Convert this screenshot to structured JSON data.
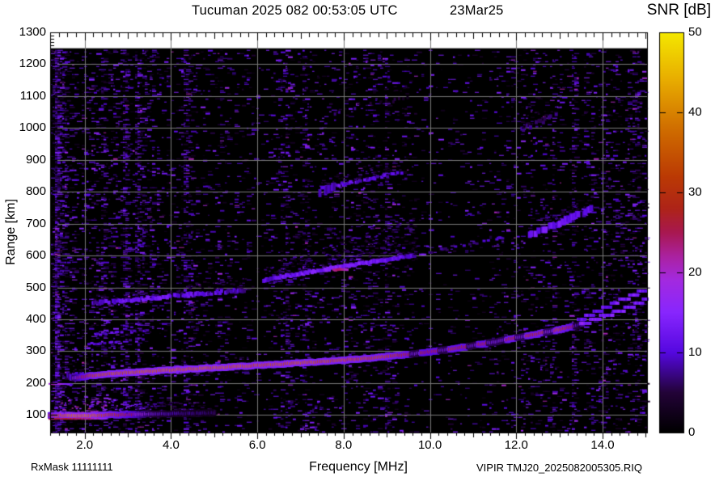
{
  "header": {
    "title": "Tucuman 2025 082 00:53:05 UTC",
    "date": "23Mar25"
  },
  "footer": {
    "rx_mask": "RxMask 11111111",
    "file_id": "VIPIR  TMJ20_2025082005305.RIQ"
  },
  "chart_data": {
    "type": "heatmap",
    "title": "Tucuman 2025 082 00:53:05 UTC  23Mar25",
    "xlabel": "Frequency [MHz]",
    "ylabel": "Range [km]",
    "colorbar_label": "SNR [dB]",
    "xlim": [
      1.2,
      15.03
    ],
    "ylim": [
      45,
      1300
    ],
    "data_top_km": 1250,
    "grid": true,
    "grid_color": "#787878",
    "plot_bg": "#000000",
    "page_bg": "#ffffff",
    "x_ticks": [
      2,
      4,
      6,
      8,
      10,
      12,
      14
    ],
    "x_tick_labels": [
      "2.0",
      "4.0",
      "6.0",
      "8.0",
      "10.0",
      "12.0",
      "14.0"
    ],
    "y_ticks": [
      100,
      200,
      300,
      400,
      500,
      600,
      700,
      800,
      900,
      1000,
      1100,
      1200,
      1300
    ],
    "colorbar": {
      "min": 0,
      "max": 50,
      "ticks": [
        0,
        10,
        20,
        30,
        40,
        50
      ],
      "stops": [
        [
          0,
          "#000000"
        ],
        [
          5,
          "#230338"
        ],
        [
          10,
          "#5508e0"
        ],
        [
          15,
          "#8826fe"
        ],
        [
          19,
          "#a32ae0"
        ],
        [
          22,
          "#ab22a0"
        ],
        [
          25,
          "#a81850"
        ],
        [
          28,
          "#ae2418"
        ],
        [
          32,
          "#bb3a04"
        ],
        [
          38,
          "#d06e00"
        ],
        [
          44,
          "#e8ac00"
        ],
        [
          50,
          "#f4e800"
        ]
      ]
    },
    "noise": {
      "base_density": 0.085,
      "snr_range": [
        2,
        15
      ],
      "bright_prob": 0.07,
      "dense_regions": [
        [
          1.2,
          1.55,
          2.1
        ],
        [
          1.2,
          3.6,
          1.55
        ],
        [
          13.6,
          15.03,
          1.45
        ],
        [
          9.6,
          11.6,
          0.6
        ]
      ],
      "stripes": [
        1.35,
        2.4,
        2.9,
        3.2,
        4.35,
        6.6,
        7.1,
        9.0,
        11.9,
        12.3,
        12.8,
        13.3,
        14.35,
        14.8
      ]
    },
    "traces": [
      {
        "name": "e-region-main",
        "th": 4,
        "w": 4,
        "glow": true,
        "jit": 1.2,
        "spread": [
          26,
          8
        ],
        "pts": [
          [
            1.2,
            99,
            30
          ],
          [
            1.5,
            99,
            38
          ],
          [
            1.8,
            98,
            40
          ],
          [
            2.1,
            98,
            40
          ],
          [
            2.4,
            99,
            36
          ],
          [
            2.7,
            100,
            31
          ],
          [
            3.0,
            101,
            27
          ],
          [
            3.3,
            102,
            20
          ],
          [
            3.6,
            103,
            13
          ],
          [
            4.0,
            104,
            10
          ],
          [
            4.5,
            105,
            8
          ],
          [
            5.0,
            106,
            7
          ]
        ]
      },
      {
        "name": "e-region-subline",
        "th": 2,
        "w": 4,
        "jit": 0.6,
        "pts": [
          [
            1.2,
            88,
            24
          ],
          [
            1.7,
            88,
            26
          ],
          [
            2.2,
            88,
            22
          ],
          [
            2.5,
            88,
            15
          ]
        ]
      },
      {
        "name": "f-start-halo",
        "th": 8,
        "w": 4,
        "gap": 0.3,
        "jit": 5,
        "spread": [
          16,
          5
        ],
        "pts": [
          [
            1.55,
            228,
            7
          ],
          [
            1.75,
            222,
            9
          ],
          [
            1.95,
            220,
            8
          ]
        ]
      },
      {
        "name": "f-region-main",
        "th": 4,
        "w": 4,
        "glow": true,
        "jit": 1.4,
        "flicker": [
          9.55,
          13.5
        ],
        "pts": [
          [
            1.75,
            215,
            16
          ],
          [
            1.95,
            219,
            26
          ],
          [
            2.2,
            224,
            34
          ],
          [
            2.6,
            229,
            36
          ],
          [
            3.0,
            233,
            36
          ],
          [
            3.5,
            237,
            37
          ],
          [
            4.0,
            241,
            37
          ],
          [
            5.0,
            248,
            37
          ],
          [
            6.0,
            255,
            36
          ],
          [
            7.0,
            263,
            36
          ],
          [
            8.0,
            272,
            35
          ],
          [
            8.5,
            277,
            34
          ],
          [
            9.0,
            283,
            33
          ],
          [
            9.5,
            290,
            29
          ],
          [
            10.0,
            298,
            26
          ],
          [
            10.5,
            307,
            29
          ],
          [
            11.0,
            317,
            27
          ],
          [
            11.5,
            329,
            29
          ],
          [
            12.0,
            342,
            30
          ],
          [
            12.5,
            354,
            31
          ],
          [
            13.0,
            367,
            32
          ],
          [
            13.3,
            377,
            28
          ],
          [
            13.55,
            386,
            18
          ]
        ]
      },
      {
        "name": "f-o-branch-tail",
        "th": 4,
        "w": 5,
        "q": 5,
        "jit": 1,
        "pts": [
          [
            13.5,
            384,
            15
          ],
          [
            13.8,
            398,
            14
          ],
          [
            14.1,
            412,
            13
          ],
          [
            14.4,
            427,
            13
          ],
          [
            14.7,
            443,
            13
          ],
          [
            15.03,
            462,
            13
          ]
        ]
      },
      {
        "name": "f-x-branch-tail",
        "th": 4,
        "w": 5,
        "q": 5,
        "jit": 1,
        "gap": 0.12,
        "pts": [
          [
            13.45,
            398,
            11
          ],
          [
            13.75,
            415,
            12
          ],
          [
            14.05,
            436,
            12
          ],
          [
            14.35,
            455,
            13
          ],
          [
            14.65,
            472,
            13
          ],
          [
            15.03,
            494,
            12
          ]
        ]
      },
      {
        "name": "left-streak-200",
        "th": 2,
        "w": 4,
        "jit": 0.6,
        "pts": [
          [
            1.2,
            197,
            20
          ],
          [
            1.5,
            197,
            18
          ],
          [
            1.7,
            196,
            11
          ]
        ]
      },
      {
        "name": "dashes-325",
        "th": 3,
        "w": 4,
        "gap": 0.5,
        "jit": 2,
        "pts": [
          [
            2.1,
            322,
            9
          ],
          [
            2.5,
            327,
            10
          ],
          [
            3.0,
            332,
            9
          ],
          [
            3.4,
            337,
            8
          ]
        ]
      },
      {
        "name": "dashes-360",
        "th": 3,
        "w": 4,
        "gap": 0.5,
        "jit": 2,
        "pts": [
          [
            2.2,
            352,
            9
          ],
          [
            2.6,
            357,
            10
          ],
          [
            3.0,
            361,
            9
          ],
          [
            3.5,
            366,
            8
          ]
        ]
      },
      {
        "name": "multihop-450",
        "th": 5,
        "w": 4,
        "gap": 0.25,
        "jit": 3,
        "spread": [
          6,
          14
        ],
        "pts": [
          [
            2.2,
            450,
            9
          ],
          [
            2.8,
            458,
            11
          ],
          [
            3.4,
            465,
            12
          ],
          [
            4.0,
            472,
            12
          ],
          [
            4.6,
            479,
            11
          ],
          [
            5.2,
            486,
            10
          ],
          [
            5.7,
            491,
            8
          ]
        ]
      },
      {
        "name": "multihop-560",
        "th": 5,
        "w": 4,
        "gap": 0.18,
        "jit": 2.5,
        "spread": [
          14,
          48
        ],
        "pts": [
          [
            6.15,
            522,
            10
          ],
          [
            6.6,
            534,
            12
          ],
          [
            7.0,
            544,
            13
          ],
          [
            7.4,
            553,
            14
          ],
          [
            7.8,
            561,
            14
          ],
          [
            8.2,
            570,
            14
          ],
          [
            8.6,
            579,
            13
          ],
          [
            9.0,
            588,
            12
          ],
          [
            9.3,
            594,
            11
          ],
          [
            9.65,
            601,
            9
          ]
        ]
      },
      {
        "name": "multihop-560-hotspot",
        "th": 3,
        "w": 4,
        "jit": 1,
        "pts": [
          [
            7.78,
            554,
            24
          ],
          [
            7.95,
            557,
            25
          ],
          [
            8.08,
            556,
            21
          ]
        ]
      },
      {
        "name": "multihop-620",
        "th": 3,
        "w": 4,
        "gap": 0.55,
        "jit": 3,
        "pts": [
          [
            10.0,
            610,
            7
          ],
          [
            10.6,
            626,
            8
          ],
          [
            11.2,
            644,
            8
          ],
          [
            11.7,
            658,
            8
          ]
        ]
      },
      {
        "name": "multihop-700",
        "th": 8,
        "w": 5,
        "gap": 0.3,
        "jit": 4,
        "spread": [
          10,
          14
        ],
        "pts": [
          [
            12.25,
            662,
            10
          ],
          [
            12.55,
            678,
            12
          ],
          [
            12.85,
            694,
            12
          ],
          [
            13.15,
            711,
            12
          ],
          [
            13.45,
            728,
            11
          ],
          [
            13.75,
            746,
            10
          ]
        ]
      },
      {
        "name": "multihop-830",
        "th": 4,
        "w": 4,
        "gap": 0.4,
        "jit": 3,
        "spread": [
          8,
          16
        ],
        "pts": [
          [
            7.5,
            812,
            9
          ],
          [
            7.9,
            822,
            11
          ],
          [
            8.3,
            833,
            11
          ],
          [
            8.7,
            843,
            10
          ],
          [
            9.1,
            853,
            9
          ],
          [
            9.35,
            860,
            8
          ]
        ]
      },
      {
        "name": "multihop-805-blob",
        "th": 10,
        "w": 4,
        "gap": 0.35,
        "jit": 5,
        "pts": [
          [
            7.45,
            800,
            8
          ],
          [
            7.65,
            812,
            10
          ],
          [
            7.8,
            816,
            8
          ]
        ]
      },
      {
        "name": "patch-1020",
        "th": 5,
        "w": 4,
        "gap": 0.6,
        "jit": 5,
        "spread": [
          10,
          18
        ],
        "pts": [
          [
            12.1,
            995,
            6
          ],
          [
            12.4,
            1010,
            7
          ],
          [
            12.7,
            1025,
            7
          ],
          [
            12.95,
            1040,
            6
          ]
        ]
      },
      {
        "name": "patch-1080",
        "th": 4,
        "w": 3,
        "gap": 0.7,
        "jit": 6,
        "spread": [
          12,
          20
        ],
        "pts": [
          [
            7.7,
            1048,
            5
          ],
          [
            8.1,
            1060,
            6
          ],
          [
            8.5,
            1072,
            5
          ],
          [
            9.0,
            1085,
            5
          ],
          [
            9.5,
            1098,
            5
          ]
        ]
      }
    ]
  }
}
